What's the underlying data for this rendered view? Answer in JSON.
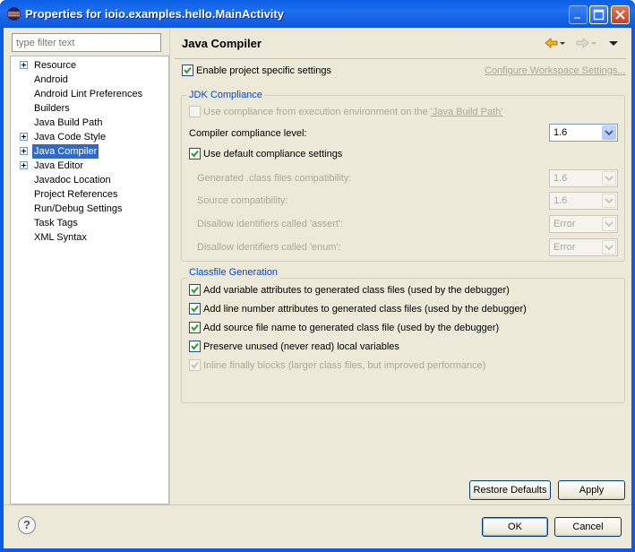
{
  "window": {
    "title": "Properties for ioio.examples.hello.MainActivity"
  },
  "filter": {
    "placeholder": "type filter text"
  },
  "tree": {
    "items": [
      {
        "label": "Resource",
        "expandable": true,
        "selected": false
      },
      {
        "label": "Android",
        "expandable": false,
        "selected": false
      },
      {
        "label": "Android Lint Preferences",
        "expandable": false,
        "selected": false
      },
      {
        "label": "Builders",
        "expandable": false,
        "selected": false
      },
      {
        "label": "Java Build Path",
        "expandable": false,
        "selected": false
      },
      {
        "label": "Java Code Style",
        "expandable": true,
        "selected": false
      },
      {
        "label": "Java Compiler",
        "expandable": true,
        "selected": true
      },
      {
        "label": "Java Editor",
        "expandable": true,
        "selected": false
      },
      {
        "label": "Javadoc Location",
        "expandable": false,
        "selected": false
      },
      {
        "label": "Project References",
        "expandable": false,
        "selected": false
      },
      {
        "label": "Run/Debug Settings",
        "expandable": false,
        "selected": false
      },
      {
        "label": "Task Tags",
        "expandable": false,
        "selected": false
      },
      {
        "label": "XML Syntax",
        "expandable": false,
        "selected": false
      }
    ]
  },
  "panel": {
    "title": "Java Compiler",
    "enable_specific": {
      "label": "Enable project specific settings",
      "checked": true
    },
    "configure_link": "Configure Workspace Settings...",
    "jdk": {
      "legend": "JDK Compliance",
      "use_env": {
        "label": "Use compliance from execution environment on the ",
        "link": "'Java Build Path'",
        "checked": false
      },
      "level_label": "Compiler compliance level:",
      "level_value": "1.6",
      "use_default": {
        "label": "Use default compliance settings",
        "checked": true
      },
      "rows": [
        {
          "label": "Generated .class files compatibility:",
          "value": "1.6"
        },
        {
          "label": "Source compatibility:",
          "value": "1.6"
        },
        {
          "label": "Disallow identifiers called 'assert':",
          "value": "Error"
        },
        {
          "label": "Disallow identifiers called 'enum':",
          "value": "Error"
        }
      ]
    },
    "classfile": {
      "legend": "Classfile Generation",
      "options": [
        {
          "label": "Add variable attributes to generated class files (used by the debugger)",
          "checked": true,
          "enabled": true
        },
        {
          "label": "Add line number attributes to generated class files (used by the debugger)",
          "checked": true,
          "enabled": true
        },
        {
          "label": "Add source file name to generated class file (used by the debugger)",
          "checked": true,
          "enabled": true
        },
        {
          "label": "Preserve unused (never read) local variables",
          "checked": true,
          "enabled": true
        },
        {
          "label": "Inline finally blocks (larger class files, but improved performance)",
          "checked": true,
          "enabled": false
        }
      ]
    },
    "restore_defaults": "Restore Defaults",
    "apply": "Apply"
  },
  "footer": {
    "help_symbol": "?",
    "ok": "OK",
    "cancel": "Cancel"
  }
}
